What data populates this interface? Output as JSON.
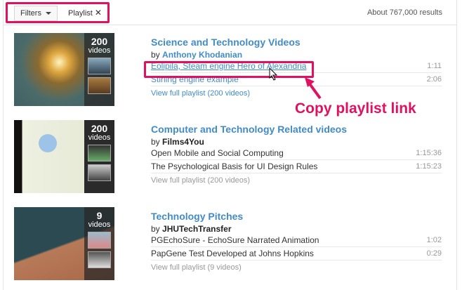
{
  "header": {
    "filters_label": "Filters",
    "active_filter": "Playlist",
    "remove_icon": "close-icon",
    "results_count": "About 767,000 results"
  },
  "results": [
    {
      "title": "Science and Technology Videos",
      "by_prefix": "by",
      "author": "Anthony Khodanian",
      "video_count": "200",
      "videos_label": "videos",
      "items": [
        {
          "title": "Eolipila, Steam engine Hero of Alexandria",
          "duration": "1:11"
        },
        {
          "title": "Stirling engine example",
          "duration": "2:06"
        }
      ],
      "view_full": "View full playlist (200 videos)"
    },
    {
      "title": "Computer and Technology Related videos",
      "by_prefix": "by",
      "author": "Films4You",
      "video_count": "200",
      "videos_label": "videos",
      "items": [
        {
          "title": "Open Mobile and Social Computing",
          "duration": "1:15:36"
        },
        {
          "title": "The Psychological Basis for UI Design Rules",
          "duration": "1:15:23"
        }
      ],
      "view_full": "View full playlist (200 videos)"
    },
    {
      "title": "Technology Pitches",
      "by_prefix": "by",
      "author": "JHUTechTransfer",
      "video_count": "9",
      "videos_label": "videos",
      "items": [
        {
          "title": "PGEchoSure - EchoSure Narrated Animation",
          "duration": "1:02"
        },
        {
          "title": "PapGene Test Developed at Johns Hopkins",
          "duration": "0:29"
        }
      ],
      "view_full": "View full playlist (9 videos)"
    }
  ],
  "annotation": {
    "callout": "Copy playlist link",
    "color": "#e0115f"
  }
}
